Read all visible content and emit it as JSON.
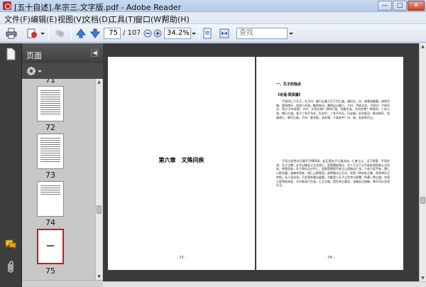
{
  "window": {
    "title": "[五十自述].牟宗三.文字版.pdf - Adobe Reader"
  },
  "menu": {
    "items": [
      "文件(F)",
      "编辑(E)",
      "视图(V)",
      "文档(D)",
      "工具(T)",
      "窗口(W)",
      "帮助(H)"
    ]
  },
  "toolbar": {
    "page_current": "75",
    "page_total": "/ 107",
    "zoom": "34.2%",
    "search_placeholder": "查找"
  },
  "sidebar": {
    "panel_title": "页面",
    "thumbnails": [
      {
        "label": "72"
      },
      {
        "label": "73"
      },
      {
        "label": "74"
      },
      {
        "label": "75",
        "selected": true
      }
    ],
    "top_partial_label": "71"
  },
  "document": {
    "left_page": {
      "chapter_title": "第六章　文殊问疾",
      "page_number": "- 73 -"
    },
    "right_page": {
      "section_heading": "一、孔子的指点",
      "subheading": "《论语·阳货篇》",
      "paragraph1": "子张问仁于孔子。孔子曰：能行五者于天下为仁矣。请问之。曰：恭宽信敏惠。恭则不侮，宽则得众，信则人任焉，敏则有功，惠则足以使人。子曰：予欲无言。子贡曰：子如不言，则小子何述焉？子曰：天何言哉？四时行焉，百物生焉，天何言哉？宰我问：三年之丧，期已久矣。君子三年不为礼，礼必坏；三年不为乐，乐必崩。旧谷既没，新谷既升，钻燧改火，期可已矣。子曰：食夫稻，衣夫锦，于女安乎？曰：安。女安则为之。",
      "paragraph2": "子贡之叹性与天道不可得而闻，此正是夫子之指点处。仁者之心，当下即是，不须外求。孔子之教，从不以概念之方式说仁，而是随处指点，令人于当下之不安处觉悟其心之所在。宰我言安，孔子即斥之曰不仁，此即是就其不安之心而指点仁也。人若于此不安，则仁心即呈露；若麻木而安，则仁心即隐没。此种指点之方式，实是一种启发之教，而非知识之传授。吾人读论语，于此等处最当留意，方能契入孔子之生命与智慧。所谓一贯之道，亦须于此等处体会，方不致流于空谈。仁之为道，是生命之真实，非概念之抽象，故不可以言语尽之。",
      "page_number": "- 74 -"
    }
  },
  "icons": {
    "print": "printer-icon",
    "email": "email-icon",
    "up": "previous-page-icon",
    "down": "next-page-icon"
  }
}
